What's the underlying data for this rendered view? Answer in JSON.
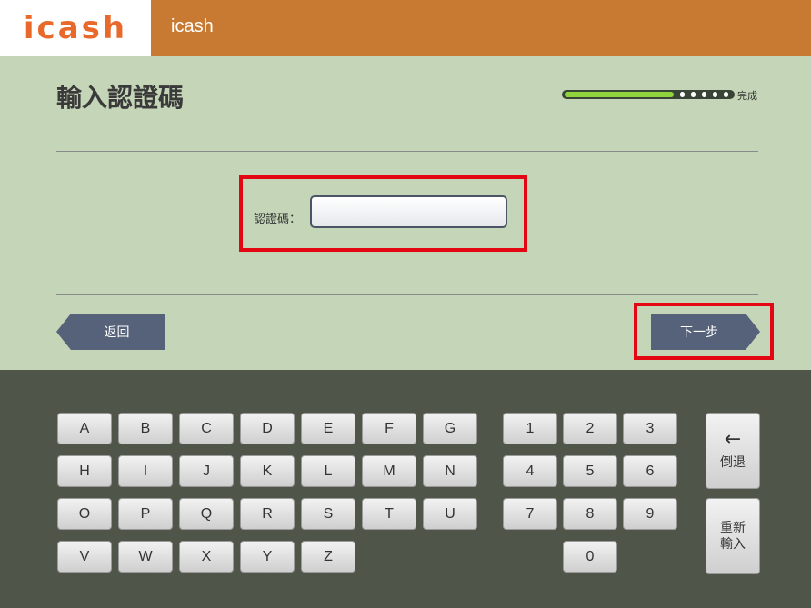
{
  "header": {
    "logo": "icash",
    "title": "icash"
  },
  "page": {
    "title": "輸入認證碼"
  },
  "progress": {
    "label": "完成",
    "fraction": 0.65,
    "steps_total": 8,
    "steps_done": 1
  },
  "form": {
    "code_label": "認證碼：",
    "code_value": ""
  },
  "nav": {
    "back_label": "返回",
    "next_label": "下一步"
  },
  "keyboard": {
    "letter_rows": [
      [
        "A",
        "B",
        "C",
        "D",
        "E",
        "F",
        "G"
      ],
      [
        "H",
        "I",
        "J",
        "K",
        "L",
        "M",
        "N"
      ],
      [
        "O",
        "P",
        "Q",
        "R",
        "S",
        "T",
        "U"
      ],
      [
        "V",
        "W",
        "X",
        "Y",
        "Z"
      ]
    ],
    "digit_rows": [
      [
        "1",
        "2",
        "3"
      ],
      [
        "4",
        "5",
        "6"
      ],
      [
        "7",
        "8",
        "9"
      ],
      [
        "0"
      ]
    ],
    "backspace_label": "倒退",
    "reenter_label": [
      "重新",
      "輸入"
    ]
  },
  "colors": {
    "header_bg": "#c87a32",
    "logo": "#e8692a",
    "main_bg": "#c5d6b8",
    "highlight": "#e30613",
    "button": "#56627a",
    "progress_fill": "#8fd43d"
  }
}
